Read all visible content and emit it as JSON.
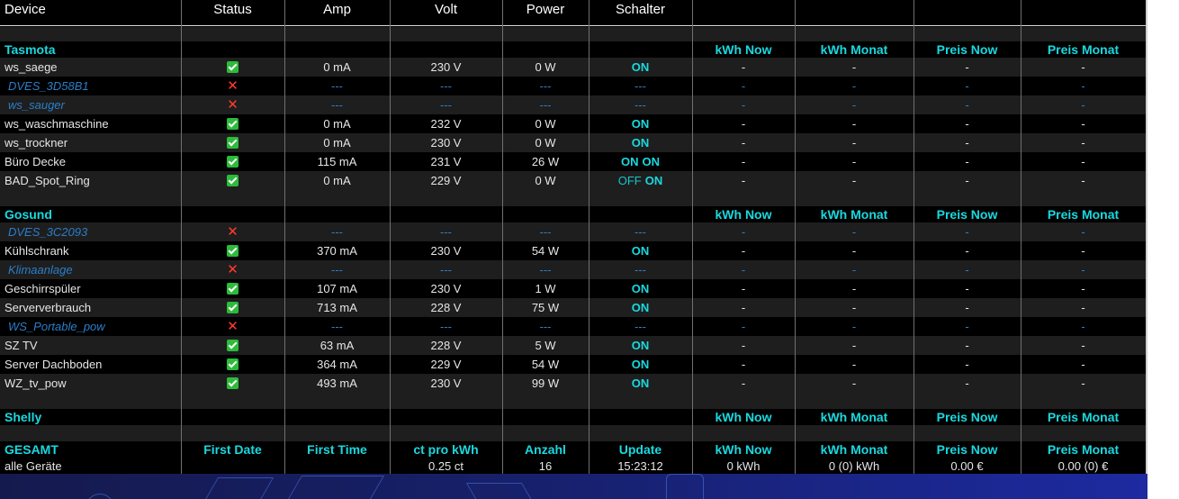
{
  "columns": [
    "Device",
    "Status",
    "Amp",
    "Volt",
    "Power",
    "Schalter",
    "",
    "",
    "",
    ""
  ],
  "groups": [
    {
      "name": "Tasmota",
      "extra_headers": [
        "kWh Now",
        "kWh Monat",
        "Preis Now",
        "Preis Monat"
      ],
      "devices": [
        {
          "name": "ws_saege",
          "online": true,
          "amp": "0 mA",
          "volt": "230 V",
          "power": "0 W",
          "switch": [
            "ON"
          ],
          "kwh_now": "-",
          "kwh_monat": "-",
          "preis_now": "-",
          "preis_monat": "-"
        },
        {
          "name": "DVES_3D58B1",
          "online": false,
          "amp": "---",
          "volt": "---",
          "power": "---",
          "switch": [
            "---"
          ],
          "kwh_now": "-",
          "kwh_monat": "-",
          "preis_now": "-",
          "preis_monat": "-"
        },
        {
          "name": "ws_sauger",
          "online": false,
          "amp": "---",
          "volt": "---",
          "power": "---",
          "switch": [
            "---"
          ],
          "kwh_now": "-",
          "kwh_monat": "-",
          "preis_now": "-",
          "preis_monat": "-"
        },
        {
          "name": "ws_waschmaschine",
          "online": true,
          "amp": "0 mA",
          "volt": "232 V",
          "power": "0 W",
          "switch": [
            "ON"
          ],
          "kwh_now": "-",
          "kwh_monat": "-",
          "preis_now": "-",
          "preis_monat": "-"
        },
        {
          "name": "ws_trockner",
          "online": true,
          "amp": "0 mA",
          "volt": "230 V",
          "power": "0 W",
          "switch": [
            "ON"
          ],
          "kwh_now": "-",
          "kwh_monat": "-",
          "preis_now": "-",
          "preis_monat": "-"
        },
        {
          "name": "Büro Decke",
          "online": true,
          "amp": "115 mA",
          "volt": "231 V",
          "power": "26 W",
          "switch": [
            "ON",
            "ON"
          ],
          "kwh_now": "-",
          "kwh_monat": "-",
          "preis_now": "-",
          "preis_monat": "-"
        },
        {
          "name": "BAD_Spot_Ring",
          "online": true,
          "amp": "0 mA",
          "volt": "229 V",
          "power": "0 W",
          "switch": [
            "OFF",
            "ON"
          ],
          "kwh_now": "-",
          "kwh_monat": "-",
          "preis_now": "-",
          "preis_monat": "-"
        }
      ]
    },
    {
      "name": "Gosund",
      "extra_headers": [
        "kWh Now",
        "kWh Monat",
        "Preis Now",
        "Preis Monat"
      ],
      "devices": [
        {
          "name": "DVES_3C2093",
          "online": false,
          "amp": "---",
          "volt": "---",
          "power": "---",
          "switch": [
            "---"
          ],
          "kwh_now": "-",
          "kwh_monat": "-",
          "preis_now": "-",
          "preis_monat": "-"
        },
        {
          "name": "Kühlschrank",
          "online": true,
          "amp": "370 mA",
          "volt": "230 V",
          "power": "54 W",
          "switch": [
            "ON"
          ],
          "kwh_now": "-",
          "kwh_monat": "-",
          "preis_now": "-",
          "preis_monat": "-"
        },
        {
          "name": "Klimaanlage",
          "online": false,
          "amp": "---",
          "volt": "---",
          "power": "---",
          "switch": [
            "---"
          ],
          "kwh_now": "-",
          "kwh_monat": "-",
          "preis_now": "-",
          "preis_monat": "-"
        },
        {
          "name": "Geschirrspüler",
          "online": true,
          "amp": "107 mA",
          "volt": "230 V",
          "power": "1 W",
          "switch": [
            "ON"
          ],
          "kwh_now": "-",
          "kwh_monat": "-",
          "preis_now": "-",
          "preis_monat": "-"
        },
        {
          "name": "Serververbrauch",
          "online": true,
          "amp": "713 mA",
          "volt": "228 V",
          "power": "75 W",
          "switch": [
            "ON"
          ],
          "kwh_now": "-",
          "kwh_monat": "-",
          "preis_now": "-",
          "preis_monat": "-"
        },
        {
          "name": "WS_Portable_pow",
          "online": false,
          "amp": "---",
          "volt": "---",
          "power": "---",
          "switch": [
            "---"
          ],
          "kwh_now": "-",
          "kwh_monat": "-",
          "preis_now": "-",
          "preis_monat": "-"
        },
        {
          "name": "SZ TV",
          "online": true,
          "amp": "63 mA",
          "volt": "228 V",
          "power": "5 W",
          "switch": [
            "ON"
          ],
          "kwh_now": "-",
          "kwh_monat": "-",
          "preis_now": "-",
          "preis_monat": "-"
        },
        {
          "name": "Server Dachboden",
          "online": true,
          "amp": "364 mA",
          "volt": "229 V",
          "power": "54 W",
          "switch": [
            "ON"
          ],
          "kwh_now": "-",
          "kwh_monat": "-",
          "preis_now": "-",
          "preis_monat": "-"
        },
        {
          "name": "WZ_tv_pow",
          "online": true,
          "amp": "493 mA",
          "volt": "230 V",
          "power": "99 W",
          "switch": [
            "ON"
          ],
          "kwh_now": "-",
          "kwh_monat": "-",
          "preis_now": "-",
          "preis_monat": "-"
        }
      ]
    },
    {
      "name": "Shelly",
      "extra_headers": [
        "kWh Now",
        "kWh Monat",
        "Preis Now",
        "Preis Monat"
      ],
      "devices": []
    }
  ],
  "summary": {
    "headers": [
      "GESAMT",
      "First Date",
      "First Time",
      "ct pro kWh",
      "Anzahl",
      "Update",
      "kWh Now",
      "kWh Monat",
      "Preis Now",
      "Preis Monat"
    ],
    "values": [
      "alle Geräte",
      "",
      "",
      "0.25 ct",
      "16",
      "15:23:12",
      "0 kWh",
      "0 (0) kWh",
      "0.00 €",
      "0.00 (0) €"
    ]
  },
  "colors": {
    "accent": "#19d9e0",
    "online": "#2cbb3a",
    "offline": "#ff3b2f",
    "offline_text": "#2a7ec9"
  }
}
